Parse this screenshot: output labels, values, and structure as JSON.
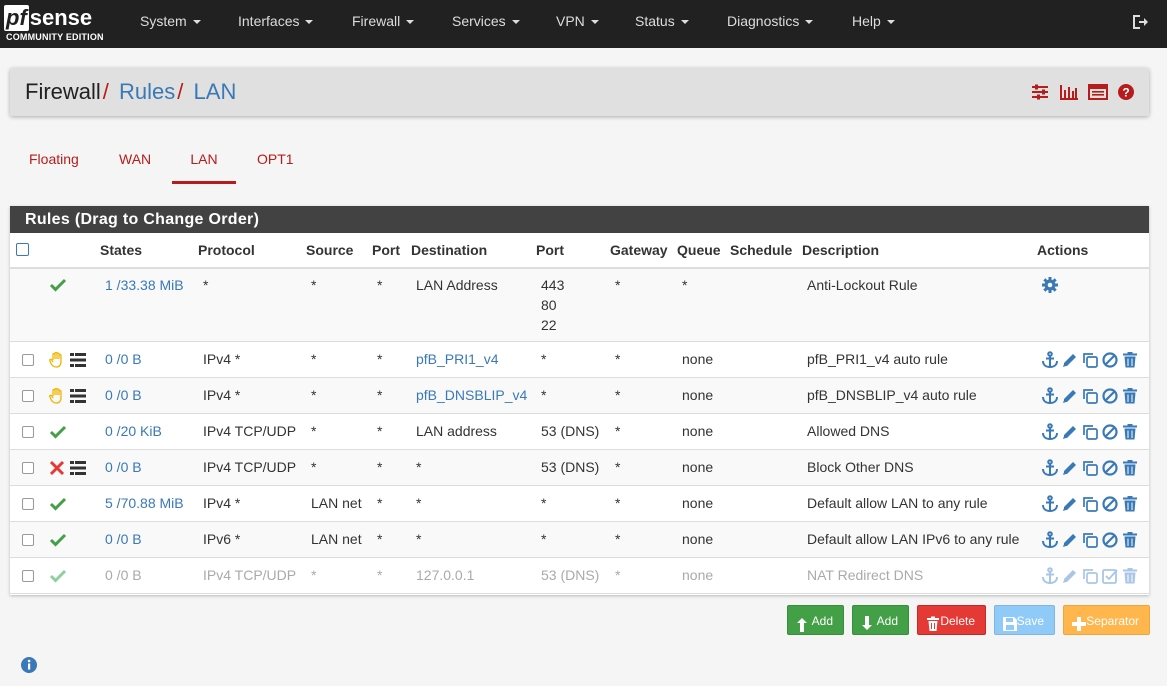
{
  "brand": {
    "name_pf": "pf",
    "name_sense": "sense",
    "edition": "COMMUNITY EDITION"
  },
  "nav": {
    "items": [
      "System",
      "Interfaces",
      "Firewall",
      "Services",
      "VPN",
      "Status",
      "Diagnostics",
      "Help"
    ]
  },
  "breadcrumb": {
    "seg0": "Firewall",
    "seg1": "Rules",
    "seg2": "LAN",
    "sep": "/"
  },
  "tabs": [
    "Floating",
    "WAN",
    "LAN",
    "OPT1"
  ],
  "panel": {
    "title": "Rules (Drag to Change Order)"
  },
  "columns": [
    "States",
    "Protocol",
    "Source",
    "Port",
    "Destination",
    "Port",
    "Gateway",
    "Queue",
    "Schedule",
    "Description",
    "Actions"
  ],
  "rows": [
    {
      "status": "pass",
      "states": "1 /33.38 MiB",
      "protocol": "*",
      "source": "*",
      "sport": "*",
      "dest": "LAN Address",
      "dport": [
        "443",
        "80",
        "22"
      ],
      "gateway": "*",
      "queue": "*",
      "schedule": "",
      "desc": "Anti-Lockout Rule"
    },
    {
      "status": "match",
      "states": "0 /0 B",
      "protocol": "IPv4 *",
      "source": "*",
      "sport": "*",
      "dest": "pfB_PRI1_v4",
      "dport": "*",
      "gateway": "*",
      "queue": "none",
      "schedule": "",
      "desc": "pfB_PRI1_v4 auto rule"
    },
    {
      "status": "match",
      "states": "0 /0 B",
      "protocol": "IPv4 *",
      "source": "*",
      "sport": "*",
      "dest": "pfB_DNSBLIP_v4",
      "dport": "*",
      "gateway": "*",
      "queue": "none",
      "schedule": "",
      "desc": "pfB_DNSBLIP_v4 auto rule"
    },
    {
      "status": "pass",
      "states": "0 /20 KiB",
      "protocol": "IPv4 TCP/UDP",
      "source": "*",
      "sport": "*",
      "dest": "LAN address",
      "dport": "53 (DNS)",
      "gateway": "*",
      "queue": "none",
      "schedule": "",
      "desc": "Allowed DNS"
    },
    {
      "status": "block",
      "states": "0 /0 B",
      "protocol": "IPv4 TCP/UDP",
      "source": "*",
      "sport": "*",
      "dest": "*",
      "dport": "53 (DNS)",
      "gateway": "*",
      "queue": "none",
      "schedule": "",
      "desc": "Block Other DNS"
    },
    {
      "status": "pass",
      "states": "5 /70.88 MiB",
      "protocol": "IPv4 *",
      "source": "LAN net",
      "sport": "*",
      "dest": "*",
      "dport": "*",
      "gateway": "*",
      "queue": "none",
      "schedule": "",
      "desc": "Default allow LAN to any rule"
    },
    {
      "status": "pass",
      "states": "0 /0 B",
      "protocol": "IPv6 *",
      "source": "LAN net",
      "sport": "*",
      "dest": "*",
      "dport": "*",
      "gateway": "*",
      "queue": "none",
      "schedule": "",
      "desc": "Default allow LAN IPv6 to any rule"
    },
    {
      "status": "pass-disabled",
      "states": "0 /0 B",
      "protocol": "IPv4 TCP/UDP",
      "source": "*",
      "sport": "*",
      "dest": "127.0.0.1",
      "dport": "53 (DNS)",
      "gateway": "*",
      "queue": "none",
      "schedule": "",
      "desc": "NAT Redirect DNS"
    }
  ],
  "buttons": {
    "add_top": "Add",
    "add_bottom": "Add",
    "delete": "Delete",
    "save": "Save",
    "separator": "Separator"
  },
  "colors": {
    "navbar": "#212121",
    "accent_red": "#b71c1c",
    "link_blue": "#3a79b7",
    "pass_green": "#43a047",
    "block_red": "#e53935",
    "match_yellow": "#f0b400"
  },
  "icons": {
    "logout": "sign-out-icon",
    "bc": [
      "sliders-icon",
      "bar-chart-icon",
      "log-list-icon",
      "help-icon"
    ],
    "info": "info-circle-icon"
  }
}
